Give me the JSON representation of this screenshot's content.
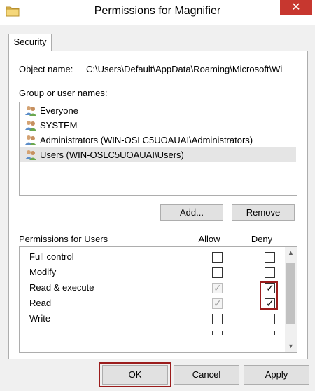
{
  "window": {
    "title": "Permissions for Magnifier",
    "icon": "folder-icon",
    "close_label": "✕"
  },
  "tabs": [
    {
      "label": "Security"
    }
  ],
  "object": {
    "label": "Object name:",
    "value": "C:\\Users\\Default\\AppData\\Roaming\\Microsoft\\Wi"
  },
  "groups": {
    "label": "Group or user names:",
    "items": [
      {
        "label": "Everyone",
        "icon": "users-icon",
        "selected": false
      },
      {
        "label": "SYSTEM",
        "icon": "users-icon",
        "selected": false
      },
      {
        "label": "Administrators (WIN-OSLC5UOAUAI\\Administrators)",
        "icon": "users-icon",
        "selected": false
      },
      {
        "label": "Users (WIN-OSLC5UOAUAI\\Users)",
        "icon": "users-icon",
        "selected": true
      }
    ],
    "add_label": "Add...",
    "remove_label": "Remove"
  },
  "permissions": {
    "label": "Permissions for Users",
    "allow_label": "Allow",
    "deny_label": "Deny",
    "rows": [
      {
        "name": "Full control",
        "allow": false,
        "allow_disabled": false,
        "deny": false
      },
      {
        "name": "Modify",
        "allow": false,
        "allow_disabled": false,
        "deny": false
      },
      {
        "name": "Read & execute",
        "allow": true,
        "allow_disabled": true,
        "deny": true
      },
      {
        "name": "Read",
        "allow": true,
        "allow_disabled": true,
        "deny": true
      },
      {
        "name": "Write",
        "allow": false,
        "allow_disabled": false,
        "deny": false
      }
    ]
  },
  "footer": {
    "ok_label": "OK",
    "cancel_label": "Cancel",
    "apply_label": "Apply"
  },
  "colors": {
    "highlight": "#9b1c1c",
    "close_button": "#c7372f",
    "selected_row": "#e5e5e5"
  }
}
